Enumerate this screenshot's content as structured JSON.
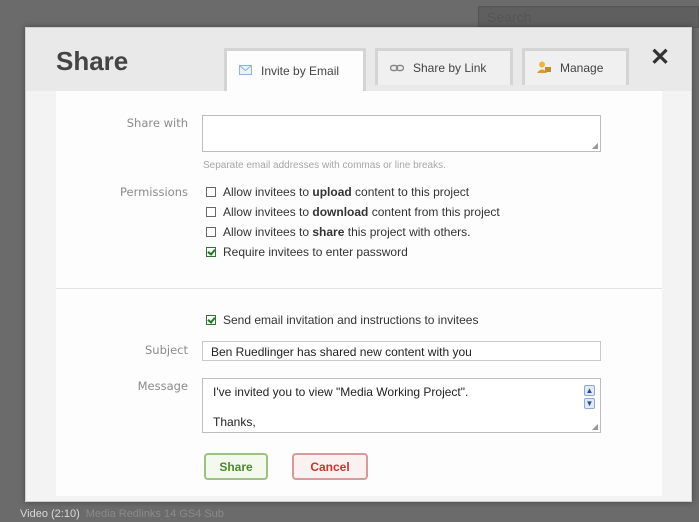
{
  "background": {
    "search_placeholder": "Search",
    "footer_left": "Video (2:10)",
    "footer_right": "Media Redlinks 14 GS4 Sub"
  },
  "dialog": {
    "title": "Share",
    "close_glyph": "✕",
    "tabs": [
      {
        "label": "Invite by Email",
        "icon": "envelope-icon",
        "active": true
      },
      {
        "label": "Share by Link",
        "icon": "link-icon",
        "active": false
      },
      {
        "label": "Manage",
        "icon": "manage-icon",
        "active": false
      }
    ]
  },
  "form": {
    "share_with_label": "Share with",
    "share_with_value": "",
    "share_with_hint": "Separate email addresses with commas or line breaks.",
    "permissions_label": "Permissions",
    "permissions": [
      {
        "prefix": "Allow invitees to ",
        "bold": "upload",
        "suffix": " content to this project",
        "checked": false
      },
      {
        "prefix": "Allow invitees to ",
        "bold": "download",
        "suffix": " content from this project",
        "checked": false
      },
      {
        "prefix": "Allow invitees to ",
        "bold": "share",
        "suffix": " this project with others.",
        "checked": false
      },
      {
        "prefix": "Require invitees to enter password",
        "bold": "",
        "suffix": "",
        "checked": true
      }
    ],
    "send_email_label": "Send email invitation and instructions to invitees",
    "send_email_checked": true,
    "subject_label": "Subject",
    "subject_value": "Ben Ruedlinger has shared new content with you",
    "message_label": "Message",
    "message_lines": [
      "I've invited you to view \"Media Working Project\".",
      "Thanks,"
    ],
    "share_button": "Share",
    "cancel_button": "Cancel"
  },
  "colors": {
    "share_button_text": "#4a8a28",
    "cancel_button_text": "#c0392b",
    "checkbox_check": "#1f7a1f"
  }
}
